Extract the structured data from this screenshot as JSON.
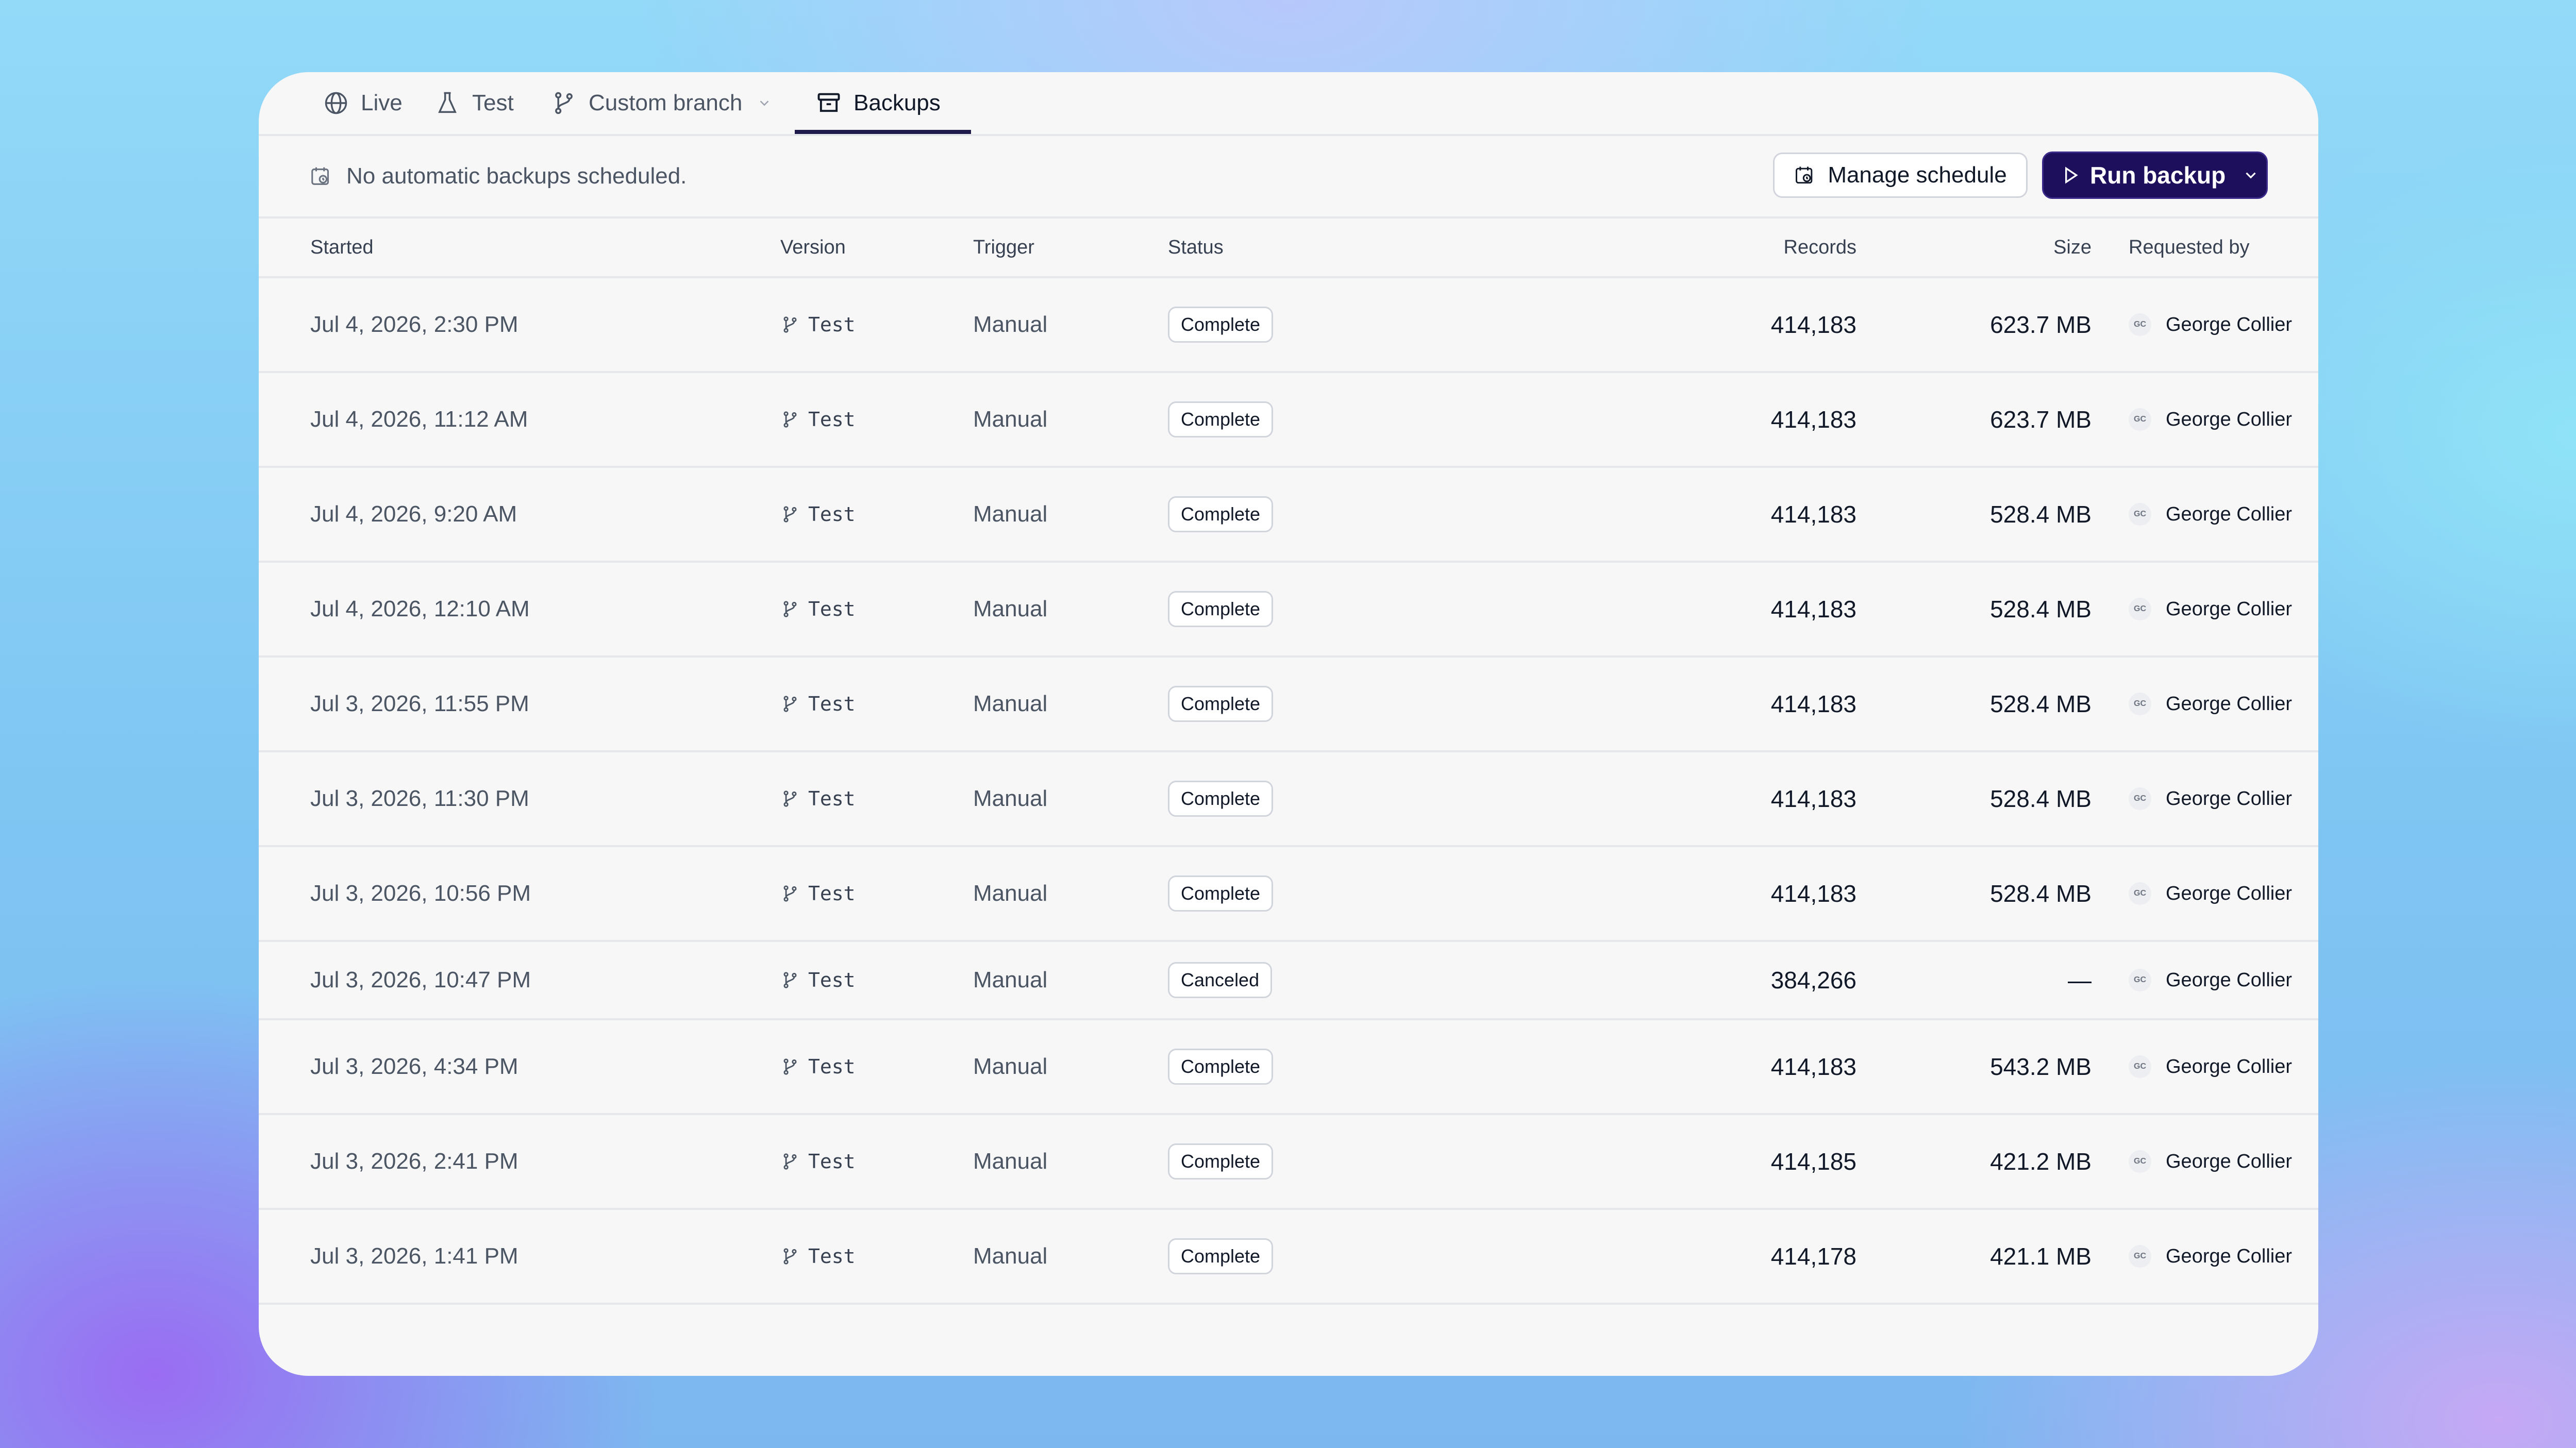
{
  "tabs": [
    {
      "label": "Live",
      "icon": "globe-icon"
    },
    {
      "label": "Test",
      "icon": "flask-icon"
    },
    {
      "label": "Custom branch",
      "icon": "branch-icon",
      "has_dropdown": true
    },
    {
      "label": "Backups",
      "icon": "archive-icon",
      "active": true
    }
  ],
  "toolbar": {
    "notice": "No automatic backups scheduled.",
    "manage_label": "Manage schedule",
    "run_label": "Run backup"
  },
  "columns": {
    "started": "Started",
    "version": "Version",
    "trigger": "Trigger",
    "status": "Status",
    "records": "Records",
    "size": "Size",
    "requested_by": "Requested by"
  },
  "rows": [
    {
      "started": "Jul 4, 2026, 2:30 PM",
      "version": "Test",
      "trigger": "Manual",
      "status": "Complete",
      "records": "414,183",
      "size": "623.7 MB",
      "initials": "GC",
      "user": "George Collier",
      "has_menu": true
    },
    {
      "started": "Jul 4, 2026, 11:12 AM",
      "version": "Test",
      "trigger": "Manual",
      "status": "Complete",
      "records": "414,183",
      "size": "623.7 MB",
      "initials": "GC",
      "user": "George Collier",
      "has_menu": true
    },
    {
      "started": "Jul 4, 2026, 9:20 AM",
      "version": "Test",
      "trigger": "Manual",
      "status": "Complete",
      "records": "414,183",
      "size": "528.4 MB",
      "initials": "GC",
      "user": "George Collier",
      "has_menu": true
    },
    {
      "started": "Jul 4, 2026, 12:10 AM",
      "version": "Test",
      "trigger": "Manual",
      "status": "Complete",
      "records": "414,183",
      "size": "528.4 MB",
      "initials": "GC",
      "user": "George Collier",
      "has_menu": true
    },
    {
      "started": "Jul 3, 2026, 11:55 PM",
      "version": "Test",
      "trigger": "Manual",
      "status": "Complete",
      "records": "414,183",
      "size": "528.4 MB",
      "initials": "GC",
      "user": "George Collier",
      "has_menu": true
    },
    {
      "started": "Jul 3, 2026, 11:30 PM",
      "version": "Test",
      "trigger": "Manual",
      "status": "Complete",
      "records": "414,183",
      "size": "528.4 MB",
      "initials": "GC",
      "user": "George Collier",
      "has_menu": true
    },
    {
      "started": "Jul 3, 2026, 10:56 PM",
      "version": "Test",
      "trigger": "Manual",
      "status": "Complete",
      "records": "414,183",
      "size": "528.4 MB",
      "initials": "GC",
      "user": "George Collier",
      "has_menu": true
    },
    {
      "started": "Jul 3, 2026, 10:47 PM",
      "version": "Test",
      "trigger": "Manual",
      "status": "Canceled",
      "records": "384,266",
      "size": "—",
      "initials": "GC",
      "user": "George Collier",
      "has_menu": false
    },
    {
      "started": "Jul 3, 2026, 4:34 PM",
      "version": "Test",
      "trigger": "Manual",
      "status": "Complete",
      "records": "414,183",
      "size": "543.2 MB",
      "initials": "GC",
      "user": "George Collier",
      "has_menu": true
    },
    {
      "started": "Jul 3, 2026, 2:41 PM",
      "version": "Test",
      "trigger": "Manual",
      "status": "Complete",
      "records": "414,185",
      "size": "421.2 MB",
      "initials": "GC",
      "user": "George Collier",
      "has_menu": true
    },
    {
      "started": "Jul 3, 2026, 1:41 PM",
      "version": "Test",
      "trigger": "Manual",
      "status": "Complete",
      "records": "414,178",
      "size": "421.1 MB",
      "initials": "GC",
      "user": "George Collier",
      "has_menu": true
    }
  ],
  "colors": {
    "primary": "#1e0f5c",
    "accent_underline": "#1e1b4b"
  }
}
